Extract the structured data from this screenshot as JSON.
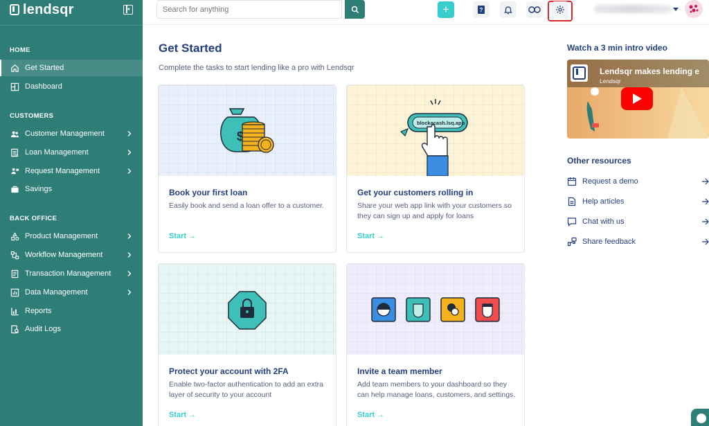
{
  "brand": {
    "name": "lendsqr"
  },
  "topbar": {
    "search_placeholder": "Search for anything",
    "user_name_hidden": ""
  },
  "sidebar": {
    "sections": [
      {
        "title": "HOME",
        "items": [
          {
            "label": "Get Started",
            "icon": "home-icon",
            "active": true
          },
          {
            "label": "Dashboard",
            "icon": "dashboard-icon"
          }
        ]
      },
      {
        "title": "CUSTOMERS",
        "items": [
          {
            "label": "Customer Management",
            "icon": "users-icon",
            "has_chevron": true
          },
          {
            "label": "Loan Management",
            "icon": "loan-icon",
            "has_chevron": true
          },
          {
            "label": "Request Management",
            "icon": "request-icon",
            "has_chevron": true
          },
          {
            "label": "Savings",
            "icon": "savings-icon"
          }
        ]
      },
      {
        "title": "BACK OFFICE",
        "items": [
          {
            "label": "Product Management",
            "icon": "product-icon",
            "has_chevron": true
          },
          {
            "label": "Workflow Management",
            "icon": "workflow-icon",
            "has_chevron": true
          },
          {
            "label": "Transaction Management",
            "icon": "transaction-icon",
            "has_chevron": true
          },
          {
            "label": "Data Management",
            "icon": "data-icon",
            "has_chevron": true
          },
          {
            "label": "Reports",
            "icon": "reports-icon"
          },
          {
            "label": "Audit Logs",
            "icon": "audit-icon"
          }
        ]
      }
    ]
  },
  "main": {
    "title": "Get Started",
    "subtitle": "Complete the tasks to start lending like a pro with Lendsqr",
    "cards": [
      {
        "title": "Book your first loan",
        "description": "Easily book and send a loan offer to a customer.",
        "link": "Start →",
        "illus_bg": "#e8f1fb"
      },
      {
        "title": "Get your customers rolling in",
        "description": "Share your web app link with your customers so they can sign up and apply for loans",
        "link": "Start →",
        "illus_bg": "#fdf4d8",
        "illus_text": "blockacash.lsq.app"
      },
      {
        "title": "Protect your account with 2FA",
        "description": "Enable two-factor authentication to add an extra layer of security to your account",
        "link": "Start →",
        "illus_bg": "#e7f5f4"
      },
      {
        "title": "Invite a team member",
        "description": "Add team members to your dashboard so they can help manage loans, customers, and settings.",
        "link": "Start →",
        "illus_bg": "#efedfb"
      }
    ]
  },
  "right": {
    "video_heading": "Watch a 3 min intro video",
    "video_title": "Lendsqr makes lending e",
    "video_channel": "Lendsqr",
    "resources_heading": "Other resources",
    "resources": [
      {
        "label": "Request a demo",
        "icon": "calendar-icon"
      },
      {
        "label": "Help articles",
        "icon": "document-icon"
      },
      {
        "label": "Chat with us",
        "icon": "chat-icon"
      },
      {
        "label": "Share feedback",
        "icon": "feedback-icon"
      }
    ]
  },
  "colors": {
    "sidebar": "#2e7d76",
    "accent": "#39cdcc",
    "text": "#213f7d",
    "highlight": "#d92b2b"
  }
}
